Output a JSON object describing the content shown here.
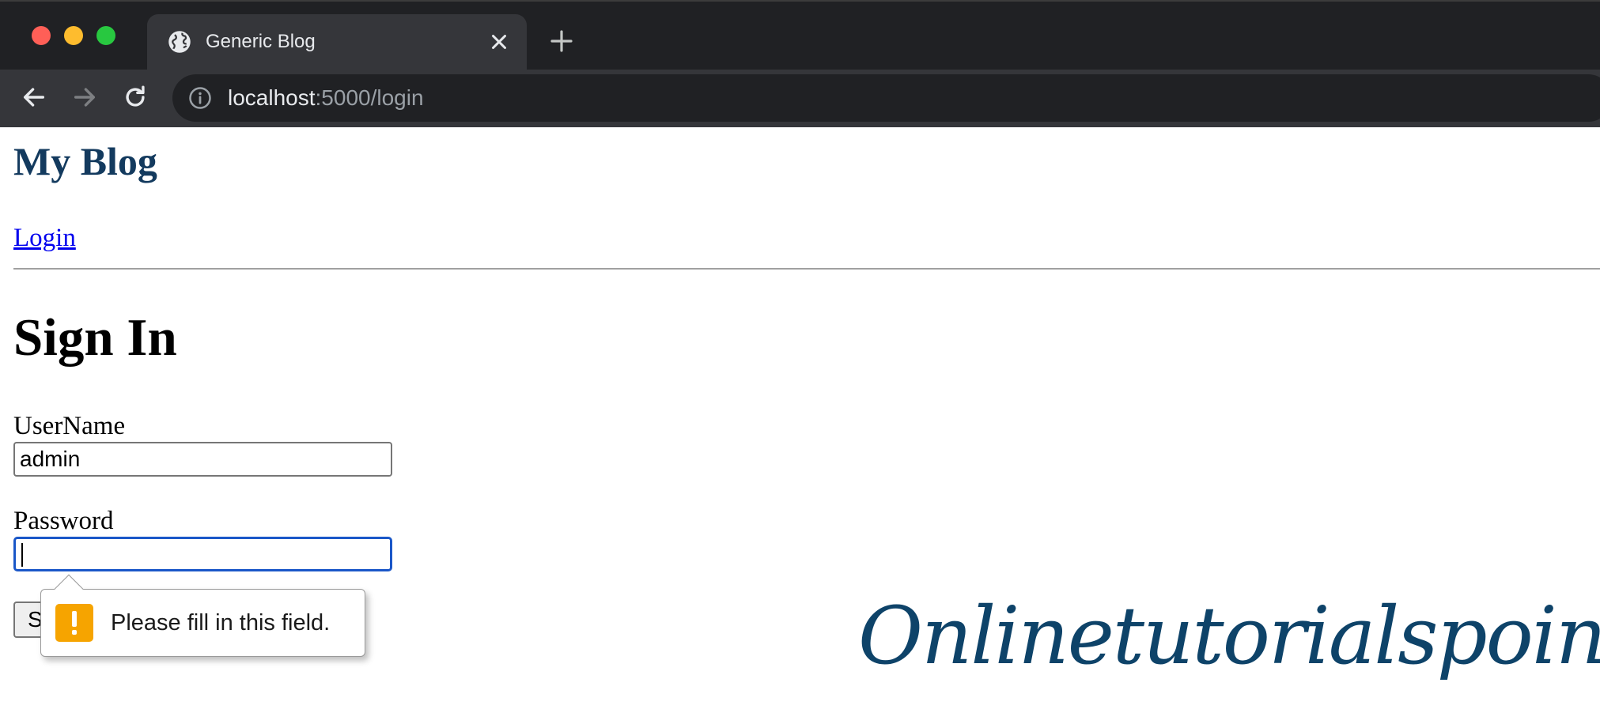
{
  "browser": {
    "tab_title": "Generic Blog",
    "url_host": "localhost",
    "url_rest": ":5000/login",
    "icons": {
      "back": "arrow-left-icon",
      "forward": "arrow-right-icon",
      "reload": "reload-icon",
      "info": "info-icon",
      "tab_favicon": "globe-icon",
      "tab_close": "close-icon",
      "new_tab": "plus-icon"
    }
  },
  "page": {
    "site_title": "My Blog",
    "nav_login": "Login",
    "heading": "Sign In",
    "username_label": "UserName",
    "username_value": "admin",
    "password_label": "Password",
    "password_value": "",
    "submit_label": "S",
    "validation_message": "Please fill in this field.",
    "watermark": "Onlinetutorialspoint"
  },
  "colors": {
    "site_title": "#133a5e",
    "link": "#0000ee",
    "focus_ring": "#1a57c8",
    "warning": "#f6a400",
    "watermark": "#0e4369"
  }
}
